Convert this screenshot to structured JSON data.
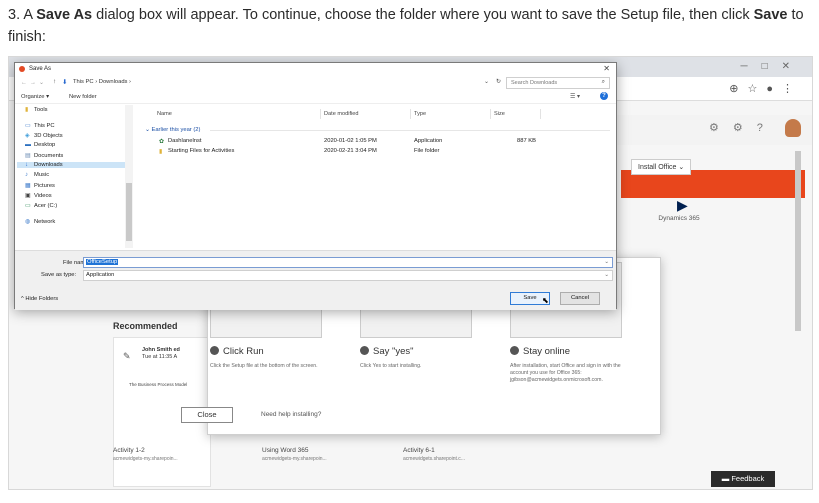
{
  "instruction": {
    "prefix": "3. A ",
    "bold1": "Save As",
    "mid": " dialog box will appear. To continue, choose the folder where you want to save the Setup file, then click ",
    "bold2": "Save",
    "suffix": " to finish:"
  },
  "background": {
    "install_office_label": "Install Office",
    "dynamics_label": "Dynamics 365",
    "feedback_label": "Feedback",
    "recommended_title": "Recommended",
    "recommended_user": "John Smith ed",
    "recommended_time": "Tue at 11:35 A",
    "rec_doc_title": "The Business Process Model",
    "activities": [
      {
        "title": "Activity 1-2",
        "sub": "acmewidgets-my.sharepoin..."
      },
      {
        "title": "Using Word 365",
        "sub": "acmewidgets-my.sharepoin..."
      },
      {
        "title": "Activity 6-1",
        "sub": "acmewidgets.sharepoint.c..."
      }
    ]
  },
  "install_dialog": {
    "steps": [
      {
        "num": "1",
        "title": "Click Run",
        "desc": "Click the Setup file at the bottom of the screen."
      },
      {
        "num": "2",
        "title": "Say \"yes\"",
        "desc": "Click Yes to start installing."
      },
      {
        "num": "3",
        "title": "Stay online",
        "desc": "After installation, start Office and sign in with the account you use for Office 365: jgibson@acmewidgets.onmicrosoft.com."
      }
    ],
    "close_label": "Close",
    "help_label": "Need help installing?"
  },
  "save_as": {
    "title": "Save As",
    "path": "This PC  ›  Downloads  ›",
    "search_placeholder": "Search Downloads",
    "organize_label": "Organize ▾",
    "new_folder_label": "New folder",
    "nav_items": [
      {
        "icon": "folder-icon",
        "glyph": "▮",
        "label": "Tools"
      },
      {
        "icon": "pc-icon",
        "glyph": "▭",
        "label": "This PC"
      },
      {
        "icon": "cube-icon",
        "glyph": "◈",
        "label": "3D Objects"
      },
      {
        "icon": "desktop-icon",
        "glyph": "▬",
        "label": "Desktop"
      },
      {
        "icon": "document-icon",
        "glyph": "▤",
        "label": "Documents"
      },
      {
        "icon": "download-icon",
        "glyph": "↓",
        "label": "Downloads"
      },
      {
        "icon": "music-icon",
        "glyph": "♪",
        "label": "Music"
      },
      {
        "icon": "pictures-icon",
        "glyph": "▦",
        "label": "Pictures"
      },
      {
        "icon": "video-icon",
        "glyph": "▣",
        "label": "Videos"
      },
      {
        "icon": "drive-icon",
        "glyph": "▭",
        "label": "Acer (C:)"
      },
      {
        "icon": "network-icon",
        "glyph": "◍",
        "label": "Network"
      }
    ],
    "selected_nav": "Downloads",
    "columns": [
      "Name",
      "Date modified",
      "Type",
      "Size"
    ],
    "group_header": "Earlier this year (2)",
    "files": [
      {
        "icon": "app-icon",
        "glyph": "✿",
        "name": "Dashlanelnst",
        "date": "2020-01-02 1:05 PM",
        "type": "Application",
        "size": "887 KB"
      },
      {
        "icon": "folder-icon",
        "glyph": "▮",
        "name": "Starting Files for Activities",
        "date": "2020-02-21 3:04 PM",
        "type": "File folder",
        "size": ""
      }
    ],
    "file_name_label": "File name:",
    "file_name_value": "OfficeSetup",
    "save_type_label": "Save as type:",
    "save_type_value": "Application",
    "hide_folders_label": "Hide Folders",
    "save_label": "Save",
    "cancel_label": "Cancel"
  }
}
